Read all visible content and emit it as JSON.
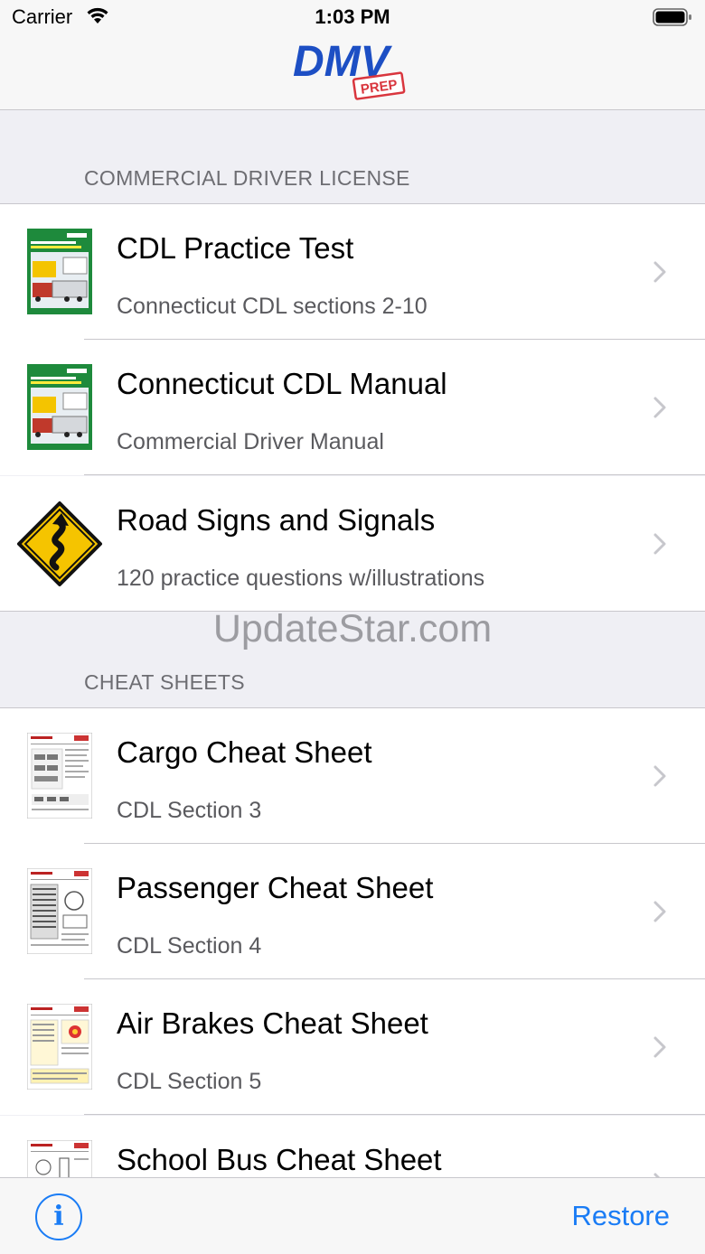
{
  "status_bar": {
    "carrier": "Carrier",
    "time": "1:03 PM"
  },
  "nav": {
    "logo_main": "DMV",
    "logo_sub": "PREP"
  },
  "sections": [
    {
      "header": "COMMERCIAL DRIVER LICENSE",
      "items": [
        {
          "title": "CDL Practice Test",
          "subtitle": "Connecticut CDL sections 2-10",
          "icon": "cdl-manual-cover-icon"
        },
        {
          "title": "Connecticut CDL Manual",
          "subtitle": "Commercial Driver Manual",
          "icon": "cdl-manual-cover-icon"
        },
        {
          "title": "Road Signs and Signals",
          "subtitle": "120 practice questions w/illustrations",
          "icon": "winding-road-sign-icon"
        }
      ]
    },
    {
      "header": "CHEAT SHEETS",
      "items": [
        {
          "title": "Cargo Cheat Sheet",
          "subtitle": "CDL Section 3",
          "icon": "cheat-sheet-thumbnail-icon"
        },
        {
          "title": "Passenger Cheat Sheet",
          "subtitle": "CDL Section 4",
          "icon": "cheat-sheet-thumbnail-icon"
        },
        {
          "title": "Air Brakes Cheat Sheet",
          "subtitle": "CDL Section 5",
          "icon": "cheat-sheet-thumbnail-icon"
        },
        {
          "title": "School Bus Cheat Sheet",
          "subtitle": "",
          "icon": "cheat-sheet-thumbnail-icon"
        }
      ]
    }
  ],
  "watermark": "UpdateStar.com",
  "toolbar": {
    "info_glyph": "i",
    "restore_label": "Restore"
  },
  "colors": {
    "accent": "#1a7cf5",
    "logo_blue": "#1d4fc4",
    "logo_red": "#d9363e",
    "sheet_green": "#1e8a3c",
    "sign_yellow": "#f5c400"
  }
}
